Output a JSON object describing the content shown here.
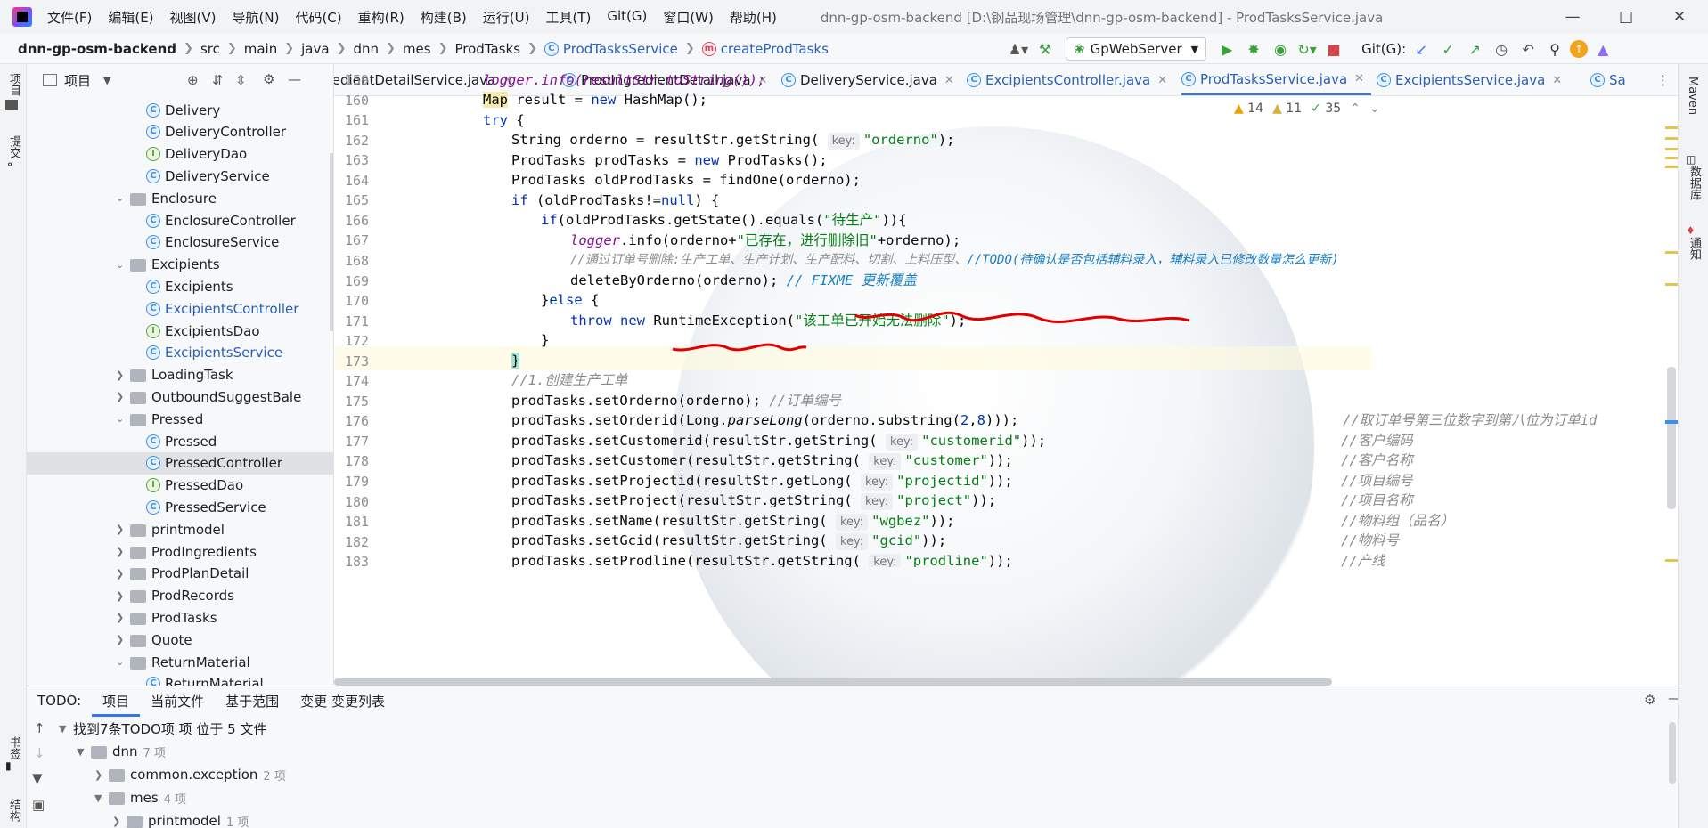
{
  "menu": [
    "文件(F)",
    "编辑(E)",
    "视图(V)",
    "导航(N)",
    "代码(C)",
    "重构(R)",
    "构建(B)",
    "运行(U)",
    "工具(T)",
    "Git(G)",
    "窗口(W)",
    "帮助(H)"
  ],
  "window_title": "dnn-gp-osm-backend [D:\\钢品现场管理\\dnn-gp-osm-backend] - ProdTasksService.java",
  "breadcrumb": [
    "dnn-gp-osm-backend",
    "src",
    "main",
    "java",
    "dnn",
    "mes",
    "ProdTasks",
    "ProdTasksService",
    "createProdTasks"
  ],
  "run_config": "GpWebServer",
  "git_label": "Git(G):",
  "project_panel": {
    "title": "项目"
  },
  "tree": [
    {
      "label": "Delivery",
      "type": "c",
      "depth": 2
    },
    {
      "label": "DeliveryController",
      "type": "c",
      "depth": 2
    },
    {
      "label": "DeliveryDao",
      "type": "i",
      "depth": 2
    },
    {
      "label": "DeliveryService",
      "type": "c",
      "depth": 2
    },
    {
      "label": "Enclosure",
      "type": "folder",
      "depth": 1,
      "open": true
    },
    {
      "label": "EnclosureController",
      "type": "c",
      "depth": 2
    },
    {
      "label": "EnclosureService",
      "type": "c",
      "depth": 2
    },
    {
      "label": "Excipients",
      "type": "folder",
      "depth": 1,
      "open": true
    },
    {
      "label": "Excipients",
      "type": "c",
      "depth": 2
    },
    {
      "label": "ExcipientsController",
      "type": "c",
      "depth": 2,
      "blue": true
    },
    {
      "label": "ExcipientsDao",
      "type": "i",
      "depth": 2
    },
    {
      "label": "ExcipientsService",
      "type": "c",
      "depth": 2,
      "blue": true
    },
    {
      "label": "LoadingTask",
      "type": "folder",
      "depth": 1
    },
    {
      "label": "OutboundSuggestBale",
      "type": "folder",
      "depth": 1
    },
    {
      "label": "Pressed",
      "type": "folder",
      "depth": 1,
      "open": true
    },
    {
      "label": "Pressed",
      "type": "c",
      "depth": 2
    },
    {
      "label": "PressedController",
      "type": "c",
      "depth": 2,
      "selected": true
    },
    {
      "label": "PressedDao",
      "type": "i",
      "depth": 2
    },
    {
      "label": "PressedService",
      "type": "c",
      "depth": 2
    },
    {
      "label": "printmodel",
      "type": "folder",
      "depth": 1
    },
    {
      "label": "ProdIngredients",
      "type": "folder",
      "depth": 1
    },
    {
      "label": "ProdPlanDetail",
      "type": "folder",
      "depth": 1
    },
    {
      "label": "ProdRecords",
      "type": "folder",
      "depth": 1
    },
    {
      "label": "ProdTasks",
      "type": "folder",
      "depth": 1
    },
    {
      "label": "Quote",
      "type": "folder",
      "depth": 1
    },
    {
      "label": "ReturnMaterial",
      "type": "folder",
      "depth": 1,
      "open": true
    },
    {
      "label": "ReturnMaterial",
      "type": "c",
      "depth": 2
    }
  ],
  "tabs": [
    "dIngredientDetailService.java",
    "ProdIngredientDetail.java",
    "DeliveryService.java",
    "ExcipientsController.java",
    "ProdTasksService.java",
    "ExcipientsService.java",
    "Sa"
  ],
  "inspections": {
    "warnings": "14",
    "weak": "11",
    "ok": "35"
  },
  "code_lines": [
    {
      "n": "159"
    },
    {
      "n": "160"
    },
    {
      "n": "161"
    },
    {
      "n": "162"
    },
    {
      "n": "163"
    },
    {
      "n": "164"
    },
    {
      "n": "165"
    },
    {
      "n": "166"
    },
    {
      "n": "167"
    },
    {
      "n": "168"
    },
    {
      "n": "169"
    },
    {
      "n": "170"
    },
    {
      "n": "171"
    },
    {
      "n": "172"
    },
    {
      "n": "173"
    },
    {
      "n": "174"
    },
    {
      "n": "175"
    },
    {
      "n": "176"
    },
    {
      "n": "177"
    },
    {
      "n": "178"
    },
    {
      "n": "179"
    },
    {
      "n": "180"
    },
    {
      "n": "181"
    },
    {
      "n": "182"
    },
    {
      "n": "183"
    }
  ],
  "code": {
    "l159": "logger.info(resultStr.toString());",
    "l160a": "Map",
    "l160b": " result = ",
    "l160c": "new",
    "l160d": " HashMap();",
    "l161a": "try",
    "l161b": " {",
    "l162a": "String orderno = resultStr.getString( ",
    "hint_key": "key:",
    "l162b": "\"orderno\"",
    "l162c": ");",
    "l163a": "ProdTasks prodTasks = ",
    "l163b": "new",
    "l163c": " ProdTasks();",
    "l164": "ProdTasks oldProdTasks = findOne(orderno);",
    "l165a": "if",
    "l165b": " (oldProdTasks!=",
    "l165c": "null",
    "l165d": ") {",
    "l166a": "if",
    "l166b": "(oldProdTasks.getState().equals(",
    "l166c": "\"待生产\"",
    "l166d": ")){",
    "l167a": "logger",
    "l167b": ".info(orderno+",
    "l167c": "\"已存在，进行删除旧\"",
    "l167d": "+orderno);",
    "l168a": "//通过订单号删除:生产工单、生产计划、生产配料、切割、上料压型、",
    "l168b": "//TODO(待确认是否包括辅料录入，辅料录入已修改数量怎么更新)",
    "l169a": "deleteByOrderno(orderno); ",
    "l169b": "// FIXME 更新覆盖",
    "l170a": "}",
    "l170b": "else",
    "l170c": " {",
    "l171a": "throw",
    "l171b": " ",
    "l171c": "new",
    "l171d": " RuntimeException(",
    "l171e": "\"该工单已开始无法删除\"",
    "l171f": ");",
    "l172": "}",
    "l173": "}",
    "l174": "//1.创建生产工单",
    "l175a": "prodTasks.setOrderno(orderno); ",
    "l175b": "//订单编号",
    "l176a": "prodTasks.setOrderid(Long.",
    "l176b": "parseLong",
    "l176c": "(orderno.substring(",
    "l176d": "2",
    "l176e": ",",
    "l176f": "8",
    "l176g": ")));",
    "l176h": "//取订单号第三位数字到第八位为订单id",
    "l177a": "prodTasks.setCustomerid(resultStr.getString( ",
    "l177b": "\"customerid\"",
    "l177c": "));",
    "l177d": "//客户编码",
    "l178a": "prodTasks.setCustomer(resultStr.getString( ",
    "l178b": "\"customer\"",
    "l178c": "));",
    "l178d": "//客户名称",
    "l179a": "prodTasks.setProjectid(resultStr.getLong( ",
    "l179b": "\"projectid\"",
    "l179c": "));",
    "l179d": "//项目编号",
    "l180a": "prodTasks.setProject(resultStr.getString( ",
    "l180b": "\"project\"",
    "l180c": "));",
    "l180d": "//项目名称",
    "l181a": "prodTasks.setName(resultStr.getString( ",
    "l181b": "\"wgbez\"",
    "l181c": "));",
    "l181d": "//物料组（品名）",
    "l182a": "prodTasks.setGcid(resultStr.getString( ",
    "l182b": "\"gcid\"",
    "l182c": "));",
    "l182d": "//物料号",
    "l183a": "prodTasks.setProdline(resultStr.getString( ",
    "l183b": "\"prodline\"",
    "l183c": "));",
    "l183d": "//产线"
  },
  "todo_panel": {
    "title": "TODO:",
    "tabs": [
      "项目",
      "当前文件",
      "基于范围",
      "变更 变更列表"
    ],
    "summary": "找到7条TODO项 项 位于 5 文件",
    "rows": [
      {
        "label": "dnn",
        "count": "7 项"
      },
      {
        "label": "common.exception",
        "count": "2 项"
      },
      {
        "label": "mes",
        "count": "4 项"
      },
      {
        "label": "printmodel",
        "count": "1 项"
      }
    ]
  },
  "left_strip": {
    "project": "项目",
    "commit": "提交",
    "bookmarks": "书签",
    "structure": "结构"
  },
  "right_strip": {
    "maven": "Maven",
    "database": "数据库",
    "notifications": "通知"
  }
}
